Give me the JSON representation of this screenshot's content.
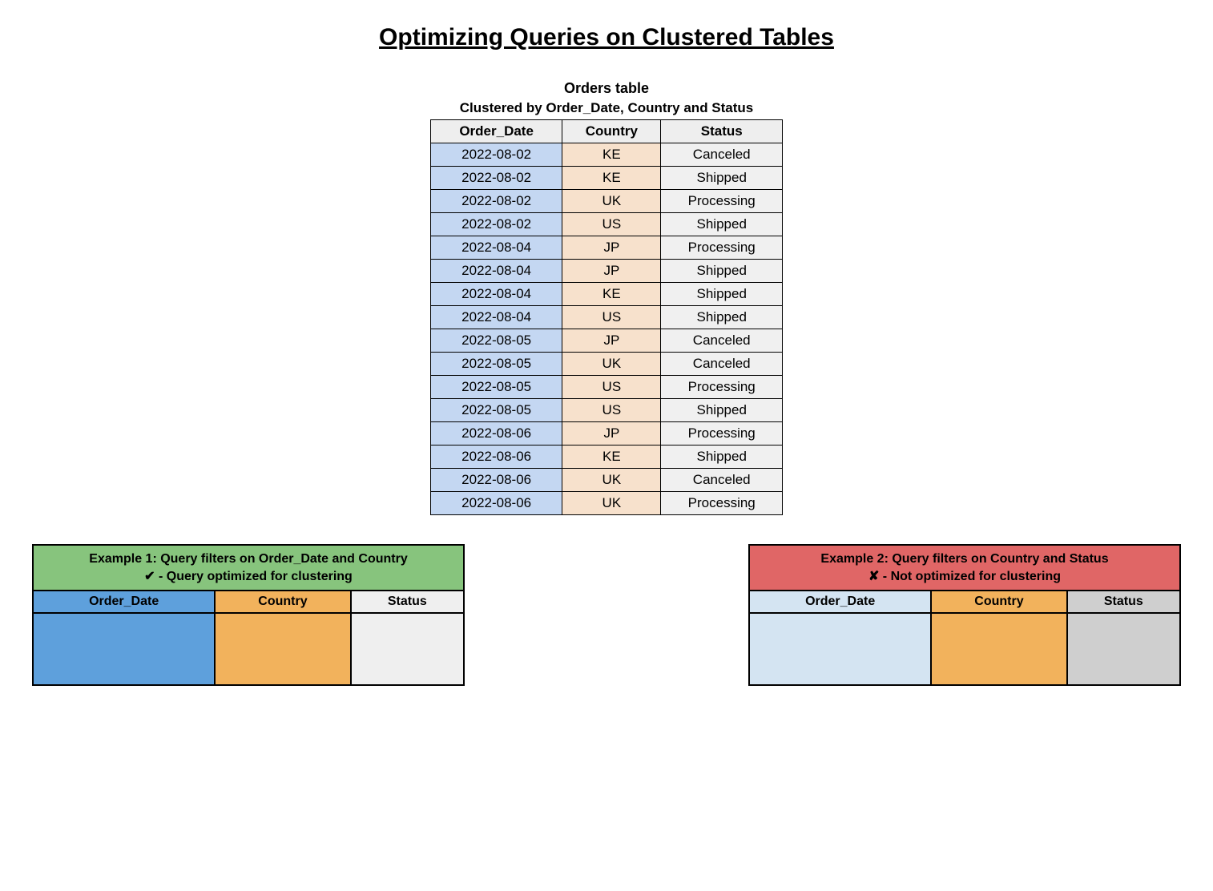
{
  "title": "Optimizing Queries on Clustered Tables",
  "orders": {
    "title": "Orders table",
    "subtitle": "Clustered by Order_Date, Country and Status",
    "headers": {
      "date": "Order_Date",
      "country": "Country",
      "status": "Status"
    },
    "rows": [
      {
        "date": "2022-08-02",
        "country": "KE",
        "status": "Canceled",
        "grp_top": true
      },
      {
        "date": "2022-08-02",
        "country": "KE",
        "status": "Shipped"
      },
      {
        "date": "2022-08-02",
        "country": "UK",
        "status": "Processing"
      },
      {
        "date": "2022-08-02",
        "country": "US",
        "status": "Shipped",
        "grp_bot": true
      },
      {
        "date": "2022-08-04",
        "country": "JP",
        "status": "Processing",
        "grp_top": true
      },
      {
        "date": "2022-08-04",
        "country": "JP",
        "status": "Shipped"
      },
      {
        "date": "2022-08-04",
        "country": "KE",
        "status": "Shipped"
      },
      {
        "date": "2022-08-04",
        "country": "US",
        "status": "Shipped",
        "grp_bot": true
      },
      {
        "date": "2022-08-05",
        "country": "JP",
        "status": "Canceled",
        "grp_top": true
      },
      {
        "date": "2022-08-05",
        "country": "UK",
        "status": "Canceled"
      },
      {
        "date": "2022-08-05",
        "country": "US",
        "status": "Processing"
      },
      {
        "date": "2022-08-05",
        "country": "US",
        "status": "Shipped",
        "grp_bot": true
      },
      {
        "date": "2022-08-06",
        "country": "JP",
        "status": "Processing",
        "grp_top": true
      },
      {
        "date": "2022-08-06",
        "country": "KE",
        "status": "Shipped"
      },
      {
        "date": "2022-08-06",
        "country": "UK",
        "status": "Canceled"
      },
      {
        "date": "2022-08-06",
        "country": "UK",
        "status": "Processing",
        "grp_bot": true
      }
    ]
  },
  "example1": {
    "title_line1": "Example 1: Query filters on Order_Date and Country",
    "title_line2": "✔ - Query optimized for clustering",
    "headers": {
      "date": "Order_Date",
      "country": "Country",
      "status": "Status"
    }
  },
  "example2": {
    "title_line1": "Example 2: Query filters on Country and Status",
    "title_line2": "✘ - Not optimized for clustering",
    "headers": {
      "date": "Order_Date",
      "country": "Country",
      "status": "Status"
    }
  }
}
